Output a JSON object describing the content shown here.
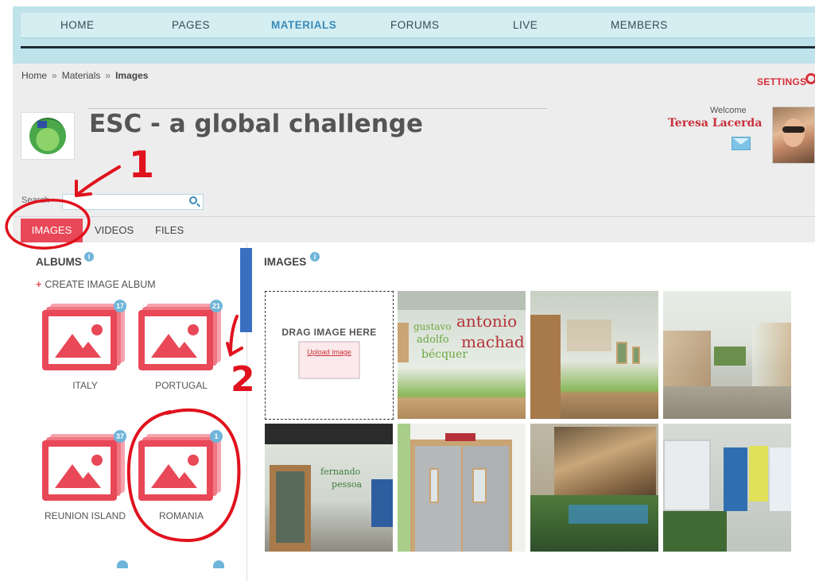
{
  "nav": {
    "items": [
      {
        "label": "HOME"
      },
      {
        "label": "PAGES"
      },
      {
        "label": "MATERIALS"
      },
      {
        "label": "FORUMS"
      },
      {
        "label": "LIVE"
      },
      {
        "label": "MEMBERS"
      }
    ]
  },
  "breadcrumb": [
    "Home",
    "Materials",
    "Images"
  ],
  "breadcrumb_separator": "»",
  "settings_label": "SETTINGS",
  "page_title": "ESC - a global challenge",
  "user": {
    "welcome": "Welcome",
    "name": "Teresa Lacerda"
  },
  "search": {
    "label": "Search"
  },
  "tabs": [
    {
      "label": "IMAGES"
    },
    {
      "label": "VIDEOS"
    },
    {
      "label": "FILES"
    }
  ],
  "albums": {
    "heading": "ALBUMS",
    "create_label": "CREATE IMAGE ALBUM",
    "items": [
      {
        "name": "ITALY",
        "count": "17"
      },
      {
        "name": "PORTUGAL",
        "count": "21"
      },
      {
        "name": "REUNION ISLAND",
        "count": "37"
      },
      {
        "name": "ROMANIA",
        "count": "1"
      }
    ]
  },
  "images": {
    "heading": "IMAGES",
    "drop_label": "DRAG IMAGE HERE",
    "upload_label": "Upload image",
    "thumb_texts": {
      "t1_line1": "gustavo",
      "t1_line2": "adolfo",
      "t1_line3": "bécquer",
      "t1_line4": "antonio",
      "t1_line5": "machado",
      "t5_line1": "fernando",
      "t5_line2": "pessoa"
    }
  },
  "annotations": {
    "one": "1",
    "two": "2"
  },
  "colors": {
    "accent_red": "#e84857",
    "nav_active": "#3a8ab8",
    "annotation_red": "#e0121d",
    "annotation_blue": "#3a6fbf"
  }
}
